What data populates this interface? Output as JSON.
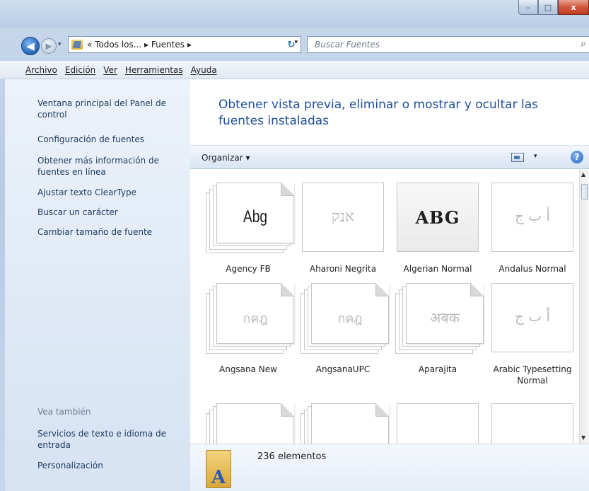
{
  "window": {
    "caption_min": "–",
    "caption_max": "□",
    "caption_close": "x"
  },
  "nav": {
    "back_glyph": "◀",
    "forward_glyph": "▶",
    "history_glyph": "▾",
    "address_text": "« Todos los...  ▸  Fuentes  ▸",
    "address_drop_glyph": "▾",
    "refresh_glyph": "↻",
    "search_placeholder": "Buscar Fuentes",
    "search_icon_glyph": "⌕"
  },
  "menubar": {
    "items": [
      "Archivo",
      "Edición",
      "Ver",
      "Herramientas",
      "Ayuda"
    ]
  },
  "leftpane": {
    "tasks": [
      "Ventana principal del Panel de control",
      "Configuración de fuentes",
      "Obtener más información de fuentes en línea",
      "Ajustar texto ClearType",
      "Buscar un carácter",
      "Cambiar tamaño de fuente"
    ],
    "see_also_title": "Vea también",
    "see_also_links": [
      "Servicios de texto e idioma de entrada",
      "Personalización"
    ]
  },
  "main": {
    "headline": "Obtener vista previa, eliminar o mostrar y ocultar las fuentes instaladas",
    "command_bar": {
      "organize_label": "Organizar ▾",
      "view_drop_glyph": "▾",
      "help_glyph": "?"
    },
    "fonts": [
      {
        "name": "Agency FB",
        "sample": "Abg",
        "stacked": true,
        "greyed": false
      },
      {
        "name": "Aharoni Negrita",
        "sample": "אנק",
        "stacked": false,
        "greyed": true
      },
      {
        "name": "Algerian Normal",
        "sample": "ABG",
        "stacked": false,
        "greyed": false
      },
      {
        "name": "Andalus Normal",
        "sample": "أ ب ج",
        "stacked": false,
        "greyed": true
      },
      {
        "name": "Angsana New",
        "sample": "กคฎ",
        "stacked": true,
        "greyed": true
      },
      {
        "name": "AngsanaUPC",
        "sample": "กคฎ",
        "stacked": true,
        "greyed": true
      },
      {
        "name": "Aparajita",
        "sample": "अबक",
        "stacked": true,
        "greyed": true
      },
      {
        "name": "Arabic Typesetting Normal",
        "sample": "أ ب ج",
        "stacked": false,
        "greyed": true
      }
    ],
    "scroll_up_glyph": "▲",
    "scroll_down_glyph": "▼"
  },
  "details": {
    "count_text": "236 elementos",
    "icon_letter": "A"
  }
}
